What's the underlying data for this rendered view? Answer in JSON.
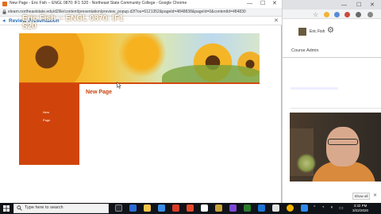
{
  "popup": {
    "window_title": "New Page - Eric Fish -- ENGL 0870: IF1 S20 - Northeast State Community College - Google Chrome",
    "url": "elearn.northeaststate.edu/d2l/le/content/presentation/preview_popup.d2l?ou=6121352&pageId=4848838&pageId=0&contentId=484830",
    "header_title": "Review Presentation",
    "controls": {
      "minimize": "—",
      "maximize": "☐",
      "close": "✕",
      "dialog_close": "✕",
      "back": "◂"
    }
  },
  "presentation": {
    "banner_title": "Eric Fish -- ENGL 0870: IF1 S20",
    "nav_items": [
      "New",
      "Page"
    ],
    "page_heading": "New Page"
  },
  "background_window": {
    "user_name": "Eric Fish",
    "nav_label": "Course Admin",
    "show_all_label": "Show all",
    "close_label": "✕",
    "controls": {
      "minimize": "—",
      "maximize": "☐",
      "close": "✕"
    },
    "star": "☆",
    "gear": "⚙"
  },
  "taskbar": {
    "search_placeholder": "Type here to search",
    "tray_up": "^",
    "clock_time": "3:32 PM",
    "clock_date": "3/22/2020"
  },
  "colors": {
    "accent_orange": "#d0440b",
    "heading_orange": "#c9420c",
    "link_blue": "#2a6fb5",
    "taskbar": "#101318"
  }
}
